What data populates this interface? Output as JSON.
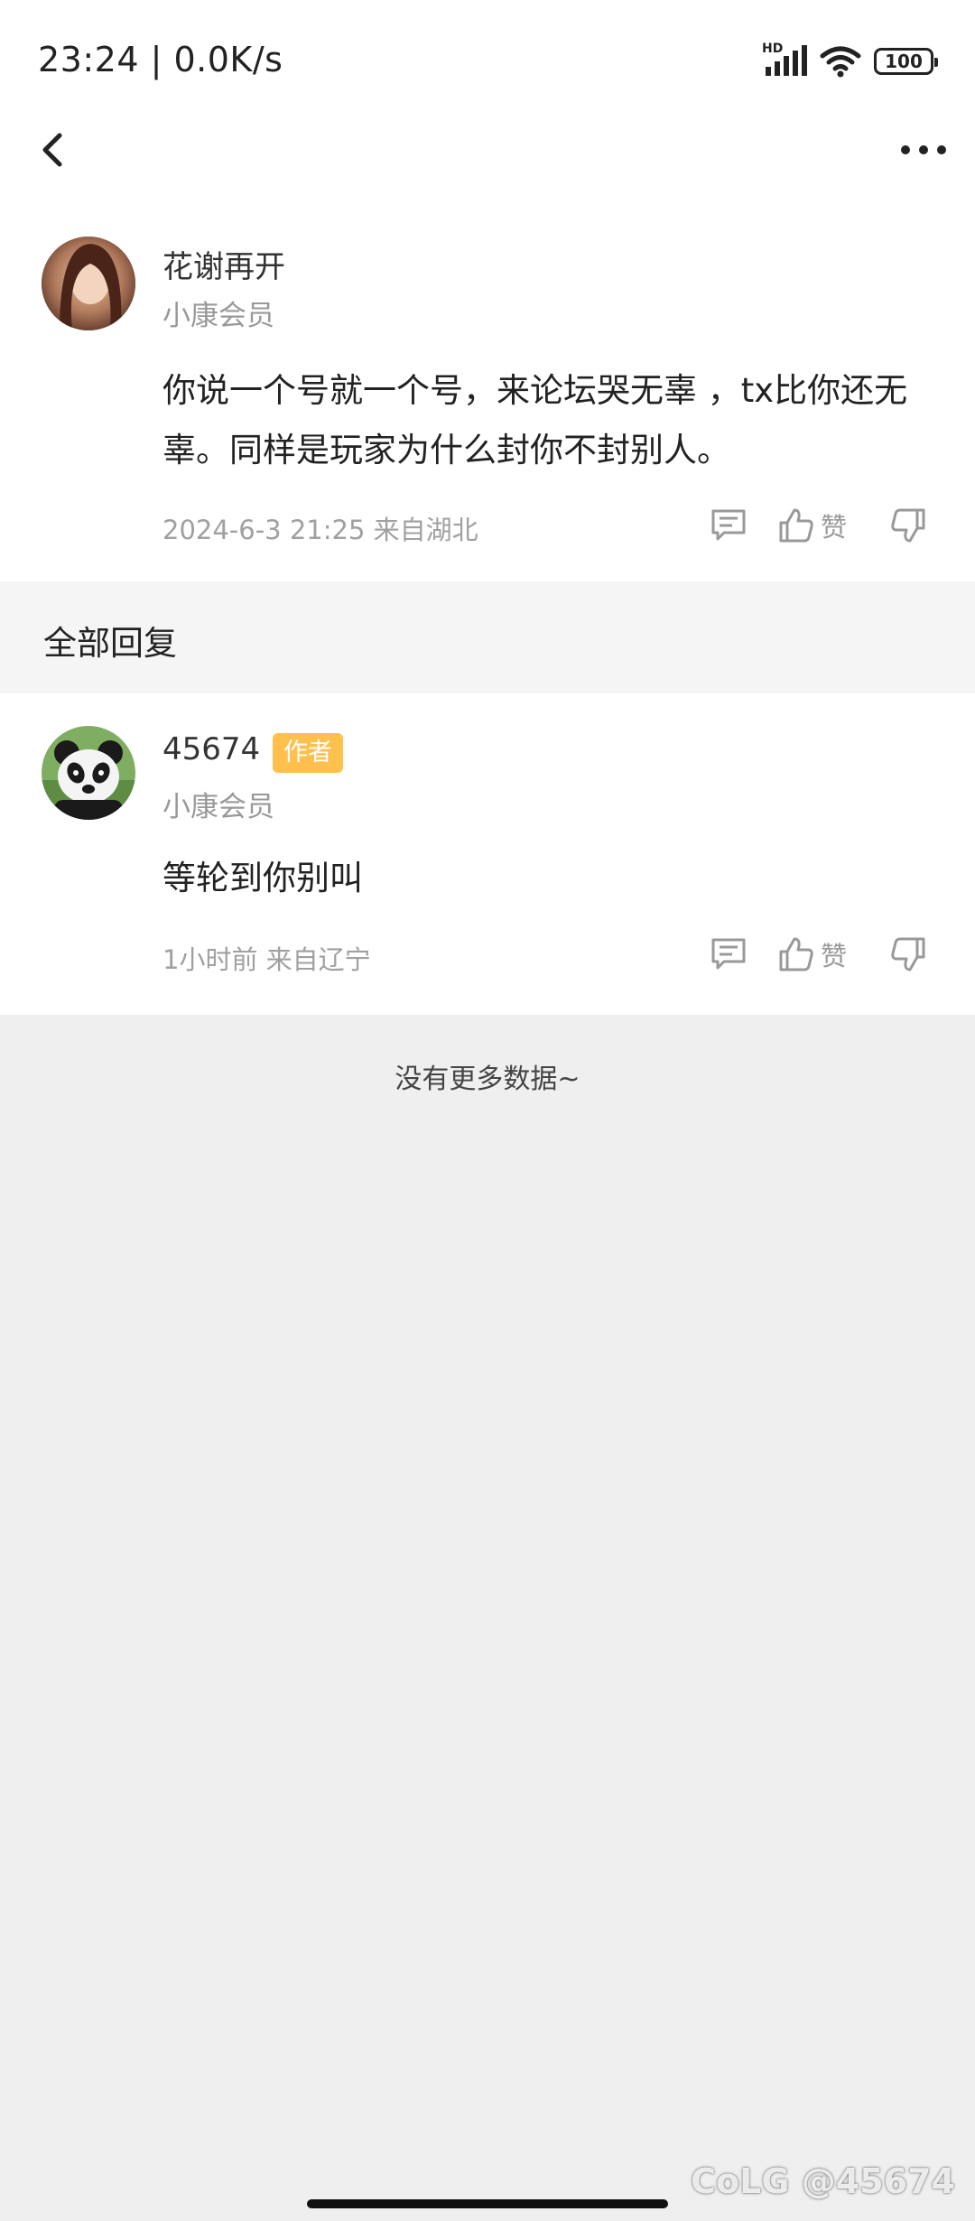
{
  "status": {
    "time_speed": "23:24 | 0.0K/s",
    "network_badge": "HD",
    "battery": "100",
    "icons": [
      "signal-icon",
      "wifi-icon",
      "battery-icon"
    ]
  },
  "nav": {
    "back_icon": "chevron-left-icon",
    "more_icon": "more-dots-icon"
  },
  "post": {
    "username": "花谢再开",
    "member": "小康会员",
    "content": "你说一个号就一个号，来论坛哭无辜 ，tx比你还无辜。同样是玩家为什么封你不封别人。",
    "meta": "2024-6-3 21:25  来自湖北",
    "like_label": "赞"
  },
  "section": {
    "title": "全部回复"
  },
  "reply": {
    "username": "45674",
    "badge": "作者",
    "member": "小康会员",
    "content": "等轮到你别叫",
    "meta": "1小时前  来自辽宁",
    "like_label": "赞"
  },
  "footer": {
    "no_more": "没有更多数据~",
    "watermark": "CoLG @45674"
  },
  "colors": {
    "badge": "#ffc04d",
    "page_bg": "#efefef",
    "card_bg": "#ffffff",
    "muted": "#999999"
  }
}
